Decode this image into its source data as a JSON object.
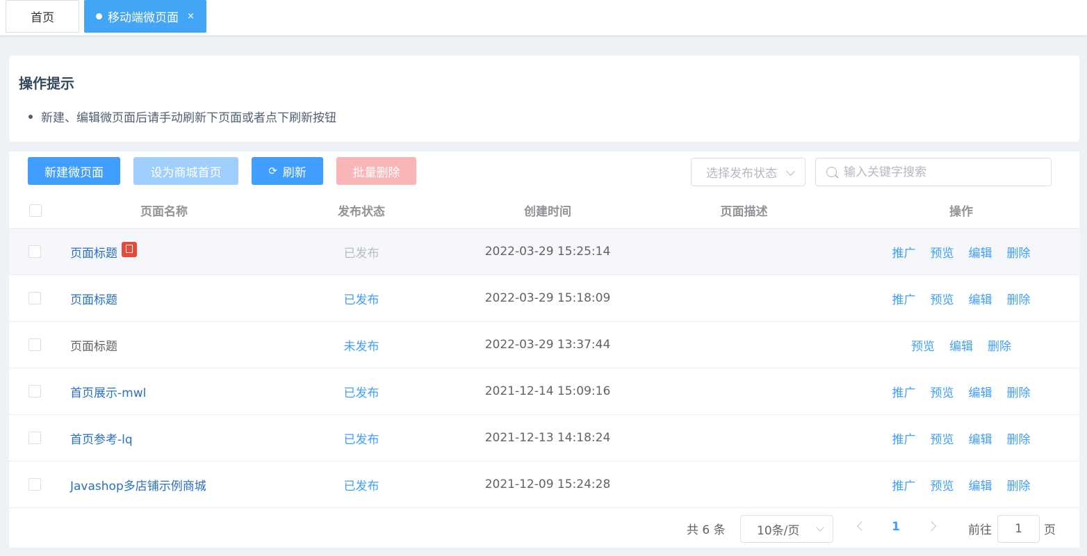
{
  "tabs": [
    {
      "label": "首页"
    },
    {
      "label": "移动端微页面",
      "close": "×"
    }
  ],
  "tip": {
    "title": "操作提示",
    "items": [
      "新建、编辑微页面后请手动刷新下页面或者点下刷新按钮"
    ]
  },
  "toolbar": {
    "new_label": "新建微页面",
    "set_home_label": "设为商城首页",
    "refresh_label": "刷新",
    "batch_delete_label": "批量删除",
    "status_placeholder": "选择发布状态",
    "search_placeholder": "输入关键字搜索"
  },
  "table": {
    "headers": {
      "name": "页面名称",
      "status": "发布状态",
      "created": "创建时间",
      "desc": "页面描述",
      "ops": "操作"
    },
    "rows": [
      {
        "name": "页面标题",
        "status": "已发布",
        "created": "2022-03-29 15:25:14",
        "ops": [
          "推广",
          "预览",
          "编辑",
          "删除"
        ]
      },
      {
        "name": "页面标题",
        "status": "已发布",
        "created": "2022-03-29 15:18:09",
        "ops": [
          "推广",
          "预览",
          "编辑",
          "删除"
        ]
      },
      {
        "name": "页面标题",
        "status": "未发布",
        "created": "2022-03-29 13:37:44",
        "ops": [
          "预览",
          "编辑",
          "删除"
        ]
      },
      {
        "name": "首页展示-mwl",
        "status": "已发布",
        "created": "2021-12-14 15:09:16",
        "ops": [
          "推广",
          "预览",
          "编辑",
          "删除"
        ]
      },
      {
        "name": "首页参考-lq",
        "status": "已发布",
        "created": "2021-12-13 14:18:24",
        "ops": [
          "推广",
          "预览",
          "编辑",
          "删除"
        ]
      },
      {
        "name": "Javashop多店铺示例商城",
        "status": "已发布",
        "created": "2021-12-09 15:24:28",
        "ops": [
          "推广",
          "预览",
          "编辑",
          "删除"
        ]
      }
    ]
  },
  "pagination": {
    "total_text": "共 6 条",
    "page_size": "10条/页",
    "current_page": "1",
    "goto_label": "前往",
    "goto_value": "1",
    "goto_suffix": "页"
  },
  "colors": {
    "primary": "#409eff",
    "active_tab": "#42a5f5",
    "danger_light": "#fab6b6",
    "home_badge": "#e64a3b"
  }
}
